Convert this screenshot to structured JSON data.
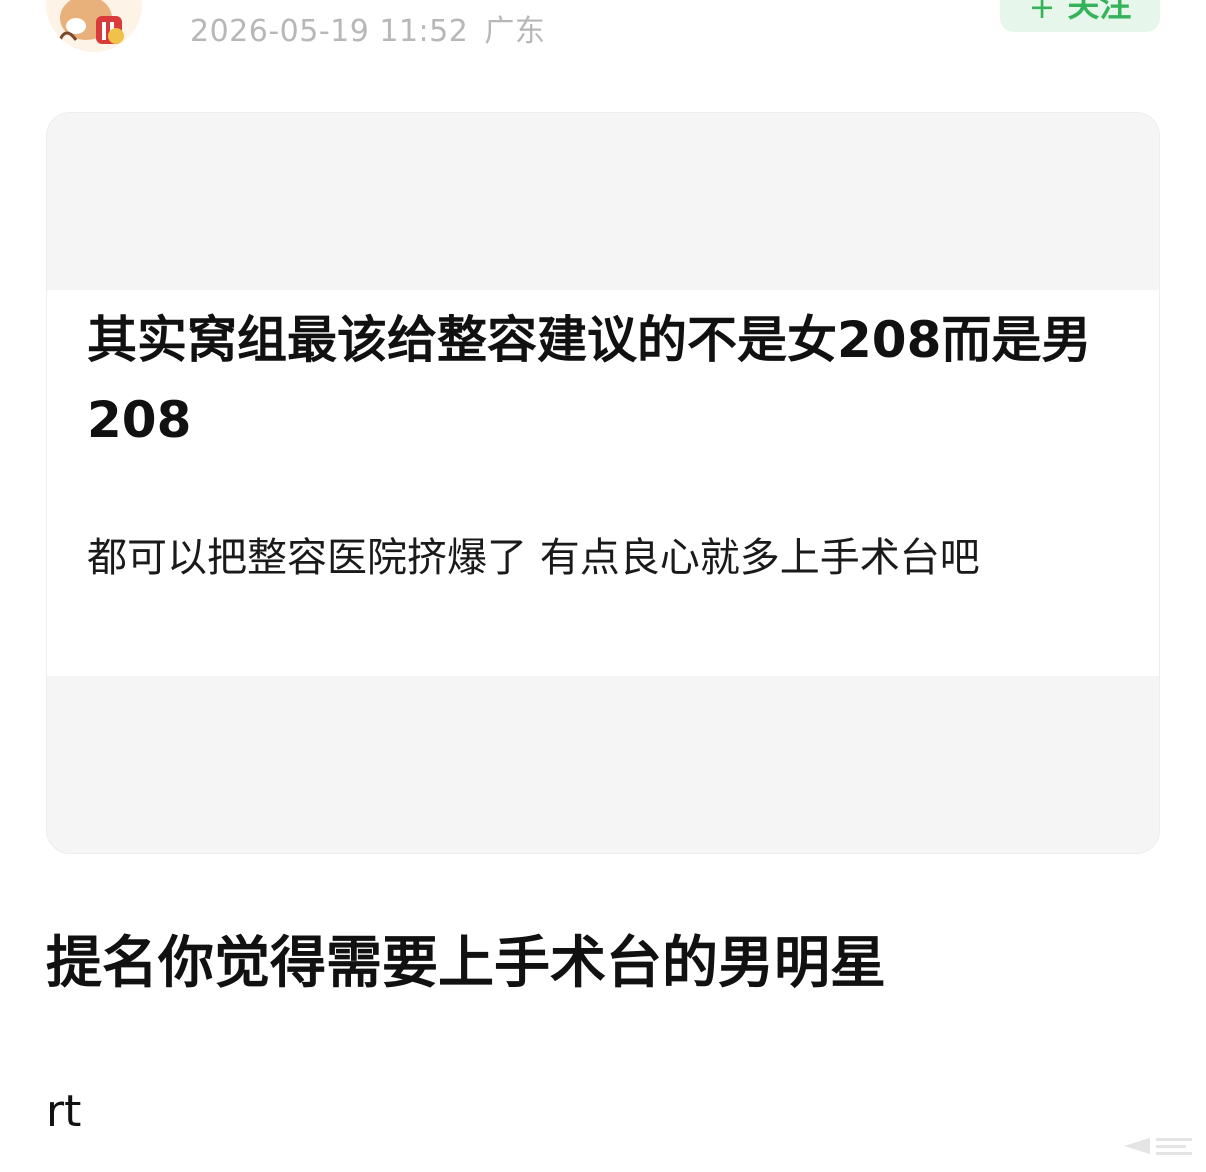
{
  "header": {
    "timestamp": "2026-05-19 11:52",
    "location": "广东",
    "follow_label": "关注",
    "follow_prefix": "+"
  },
  "image_card": {
    "headline": "其实窝组最该给整容建议的不是女208而是男208",
    "subline": "都可以把整容医院挤爆了 有点良心就多上手术台吧"
  },
  "post": {
    "title": "提名你觉得需要上手术台的男明星",
    "body": "rt"
  },
  "icons": {
    "avatar": "cartoon-avatar-icon",
    "watermark": "watermark-icon"
  },
  "colors": {
    "accent_green": "#35b35a",
    "follow_bg": "#e6f6ea",
    "meta_gray": "#b7b7b7",
    "card_bg": "#f5f5f5"
  }
}
